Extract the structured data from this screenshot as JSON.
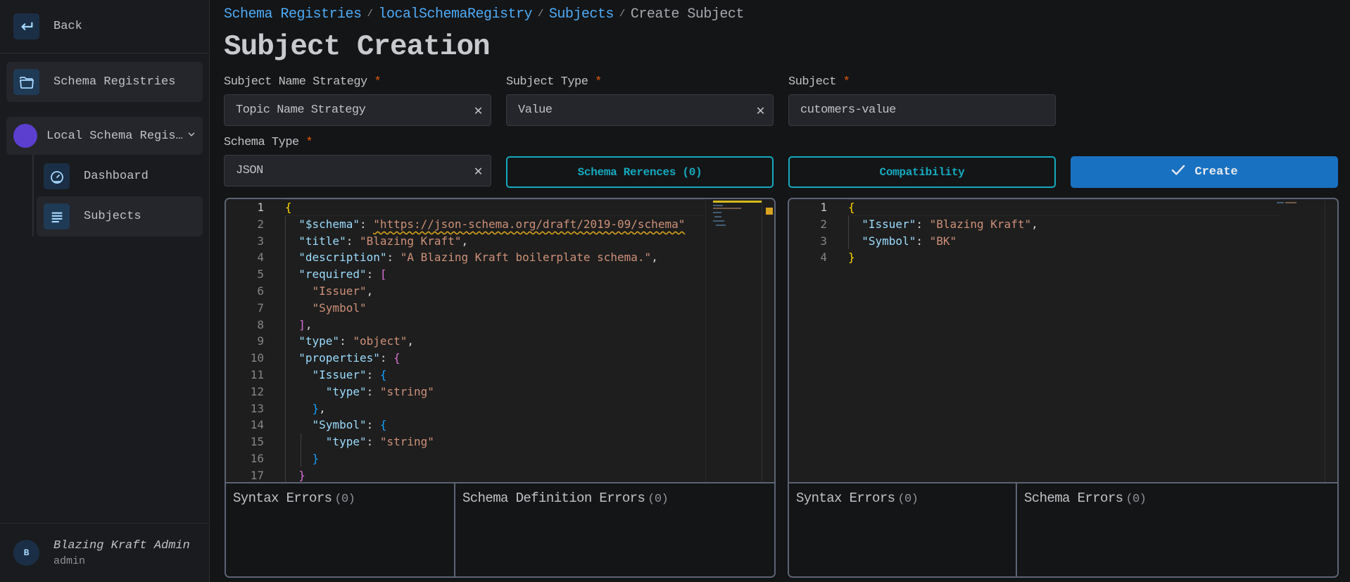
{
  "sidebar": {
    "back_label": "Back",
    "nav_schema_registries": "Schema Registries",
    "registry_name": "Local Schema Registry",
    "registry_color": "#5c3fcf",
    "sub_items": [
      {
        "label": "Dashboard",
        "icon": "gauge-icon"
      },
      {
        "label": "Subjects",
        "icon": "list-icon",
        "active": true
      }
    ],
    "user": {
      "initial": "B",
      "name": "Blazing Kraft Admin",
      "role": "admin"
    }
  },
  "breadcrumb": {
    "items": [
      "Schema Registries",
      "localSchemaRegistry",
      "Subjects"
    ],
    "separator": "/",
    "current": "Create Subject"
  },
  "page_title": "Subject Creation",
  "form": {
    "subject_name_strategy": {
      "label": "Subject Name Strategy",
      "required": "*",
      "value": "Topic Name Strategy"
    },
    "subject_type": {
      "label": "Subject Type",
      "required": "*",
      "value": "Value"
    },
    "subject": {
      "label": "Subject",
      "required": "*",
      "value": "cutomers-value"
    },
    "schema_type": {
      "label": "Schema Type",
      "required": "*",
      "value": "JSON"
    },
    "schema_references_label": "Schema Rerences (0)",
    "compatibility_label": "Compatibility",
    "create_label": "Create",
    "clear_glyph": "✕"
  },
  "schema_editor": {
    "lines": [
      "1",
      "2",
      "3",
      "4",
      "5",
      "6",
      "7",
      "8",
      "9",
      "10",
      "11",
      "12",
      "13",
      "14",
      "15",
      "16",
      "17"
    ],
    "schema_url": "\"https://json-schema.org/draft/2019-09/schema\"",
    "title": "\"Blazing Kraft\"",
    "description": "\"A Blazing Kraft boilerplate schema.\"",
    "required_1": "\"Issuer\"",
    "required_2": "\"Symbol\"",
    "type": "\"object\"",
    "prop_1": "\"Issuer\"",
    "prop_2": "\"Symbol\"",
    "prop_type": "\"string\""
  },
  "example_editor": {
    "lines": [
      "1",
      "2",
      "3",
      "4"
    ],
    "issuer_value": "\"Blazing Kraft\"",
    "symbol_value": "\"BK\""
  },
  "errors": {
    "left_syntax": {
      "label": "Syntax Errors",
      "count": "(0)"
    },
    "left_definition": {
      "label": "Schema Definition Errors",
      "count": "(0)"
    },
    "right_syntax": {
      "label": "Syntax Errors",
      "count": "(0)"
    },
    "right_schema": {
      "label": "Schema Errors",
      "count": "(0)"
    }
  }
}
